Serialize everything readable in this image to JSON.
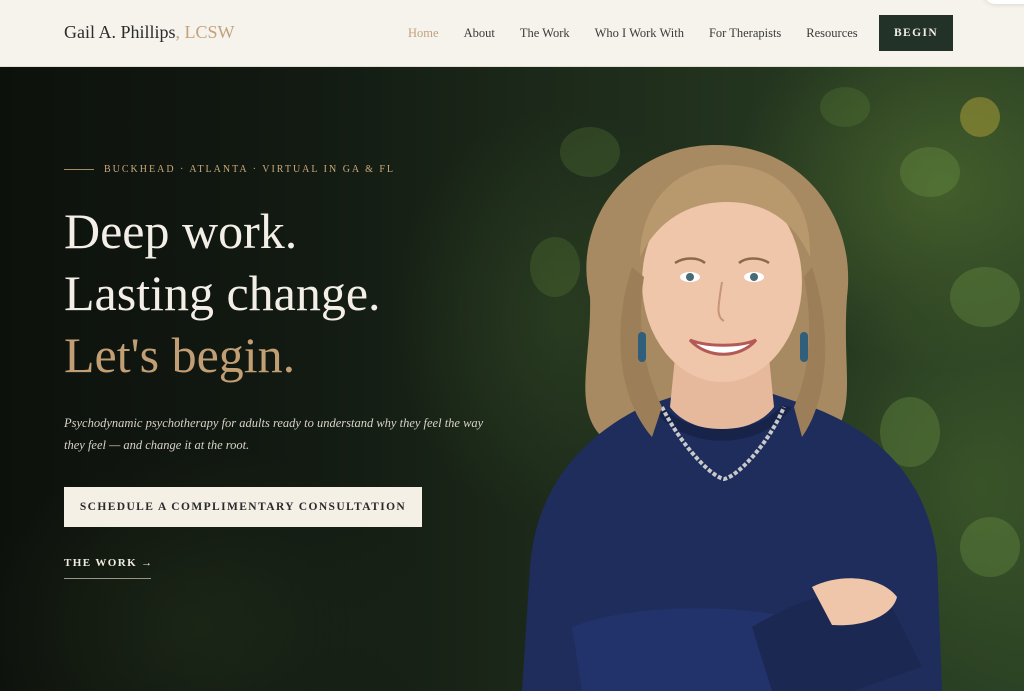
{
  "header": {
    "brand_name": "Gail A. Phillips",
    "brand_credential": ", LCSW",
    "nav": [
      {
        "label": "Home",
        "active": true
      },
      {
        "label": "About",
        "active": false
      },
      {
        "label": "The Work",
        "active": false
      },
      {
        "label": "Who I Work With",
        "active": false
      },
      {
        "label": "For Therapists",
        "active": false
      },
      {
        "label": "Resources",
        "active": false
      }
    ],
    "begin_label": "BEGIN"
  },
  "hero": {
    "eyebrow": "BUCKHEAD · ATLANTA · VIRTUAL IN GA & FL",
    "headline": [
      "Deep work.",
      "Lasting change.",
      "Let's begin."
    ],
    "subtext": "Psychodynamic psychotherapy for adults ready to understand why they feel the way they feel — and change it at the root.",
    "cta_label": "SCHEDULE A COMPLIMENTARY CONSULTATION",
    "work_link_label": "THE WORK →"
  },
  "colors": {
    "accent_gold": "#c29e74",
    "dark_green": "#233228",
    "cream": "#f6f3ec",
    "sweater_navy": "#1f2d5c"
  }
}
